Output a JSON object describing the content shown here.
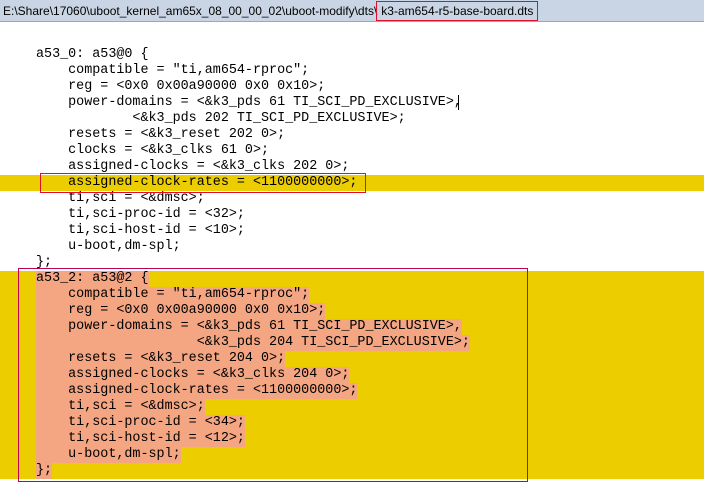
{
  "title_bar": {
    "path": "E:\\Share\\17060\\uboot_kernel_am65x_08_00_00_02\\uboot-modify\\dts\\",
    "file_name": "k3-am654-r5-base-board.dts"
  },
  "colors": {
    "highlight": "#eccd00",
    "selection": "#f4a582",
    "annotation_box": "#e0102a"
  },
  "code": {
    "lines": [
      "",
      "a53_0: a53@0 {",
      "    compatible = \"ti,am654-rproc\";",
      "    reg = <0x0 0x00a90000 0x0 0x10>;",
      "    power-domains = <&k3_pds 61 TI_SCI_PD_EXCLUSIVE>,",
      "            <&k3_pds 202 TI_SCI_PD_EXCLUSIVE>;",
      "    resets = <&k3_reset 202 0>;",
      "    clocks = <&k3_clks 61 0>;",
      "    assigned-clocks = <&k3_clks 202 0>;",
      "    assigned-clock-rates = <1100000000>;",
      "    ti,sci = <&dmsc>;",
      "    ti,sci-proc-id = <32>;",
      "    ti,sci-host-id = <10>;",
      "    u-boot,dm-spl;",
      "};",
      "a53_2: a53@2 {",
      "    compatible = \"ti,am654-rproc\";",
      "    reg = <0x0 0x00a90000 0x0 0x10>;",
      "    power-domains = <&k3_pds 61 TI_SCI_PD_EXCLUSIVE>,",
      "                    <&k3_pds 204 TI_SCI_PD_EXCLUSIVE>;",
      "    resets = <&k3_reset 204 0>;",
      "    assigned-clocks = <&k3_clks 204 0>;",
      "    assigned-clock-rates = <1100000000>;",
      "    ti,sci = <&dmsc>;",
      "    ti,sci-proc-id = <34>;",
      "    ti,sci-host-id = <12>;",
      "    u-boot,dm-spl;",
      "};"
    ]
  }
}
